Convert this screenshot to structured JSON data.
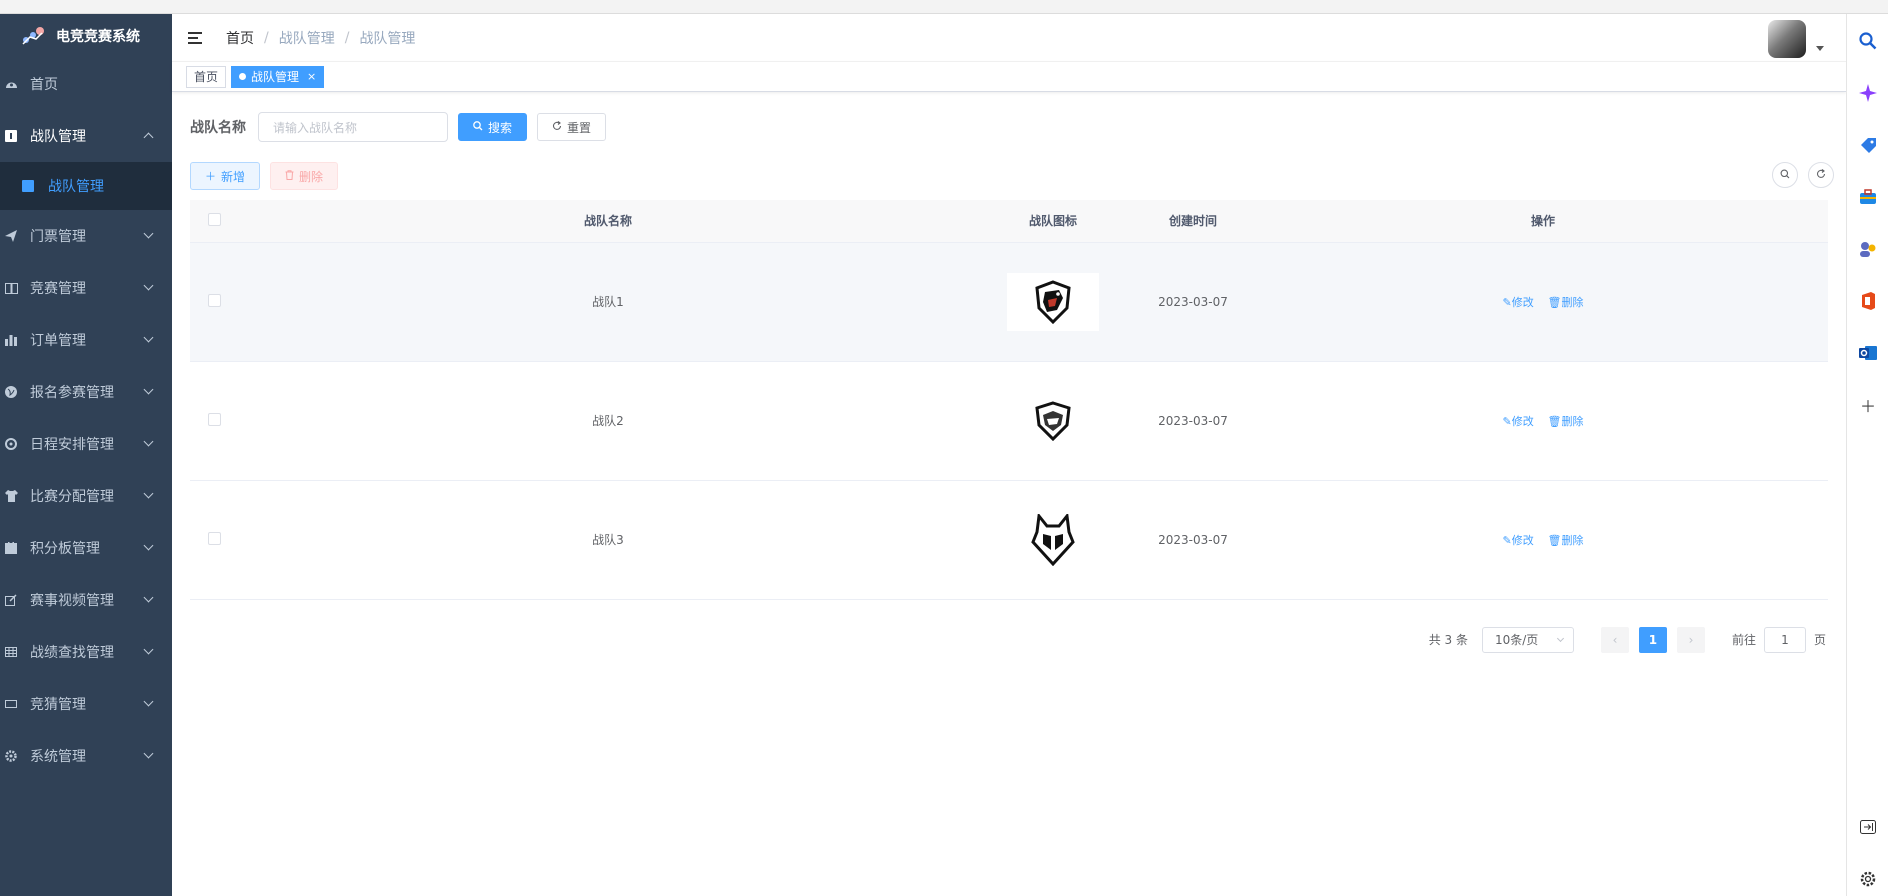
{
  "app": {
    "title": "电竞竞赛系统"
  },
  "sidebar": {
    "items": [
      {
        "label": "首页",
        "icon": "dashboard-icon"
      },
      {
        "label": "战队管理",
        "icon": "team-icon",
        "expanded": true,
        "children": [
          {
            "label": "战队管理",
            "icon": "team-icon"
          }
        ]
      },
      {
        "label": "门票管理",
        "icon": "send-icon"
      },
      {
        "label": "竞赛管理",
        "icon": "book-icon"
      },
      {
        "label": "订单管理",
        "icon": "chart-icon"
      },
      {
        "label": "报名参赛管理",
        "icon": "globe-icon"
      },
      {
        "label": "日程安排管理",
        "icon": "gear-icon"
      },
      {
        "label": "比赛分配管理",
        "icon": "shirt-icon"
      },
      {
        "label": "积分板管理",
        "icon": "clipboard-icon"
      },
      {
        "label": "赛事视频管理",
        "icon": "edit-icon"
      },
      {
        "label": "战绩查找管理",
        "icon": "table-icon"
      },
      {
        "label": "竞猜管理",
        "icon": "rect-icon"
      },
      {
        "label": "系统管理",
        "icon": "settings-icon"
      }
    ]
  },
  "navbar": {
    "breadcrumb": [
      "首页",
      "战队管理",
      "战队管理"
    ]
  },
  "tags": [
    {
      "label": "首页",
      "active": false
    },
    {
      "label": "战队管理",
      "active": true
    }
  ],
  "search": {
    "label": "战队名称",
    "placeholder": "请输入战队名称",
    "search_label": "搜索",
    "reset_label": "重置"
  },
  "toolbar": {
    "add_label": "新增",
    "delete_label": "删除"
  },
  "table": {
    "headers": [
      "战队名称",
      "战队图标",
      "创建时间",
      "操作"
    ],
    "rows": [
      {
        "name": "战队1",
        "date": "2023-03-07",
        "edit": "修改",
        "delete": "删除"
      },
      {
        "name": "战队2",
        "date": "2023-03-07",
        "edit": "修改",
        "delete": "删除"
      },
      {
        "name": "战队3",
        "date": "2023-03-07",
        "edit": "修改",
        "delete": "删除"
      }
    ]
  },
  "pagination": {
    "total_text": "共 3 条",
    "page_size": "10条/页",
    "current_page": "1",
    "goto_label": "前往",
    "goto_value": "1",
    "page_suffix": "页"
  },
  "colors": {
    "sidebar_bg": "#304156",
    "accent": "#409eff",
    "danger": "#f56c6c"
  }
}
